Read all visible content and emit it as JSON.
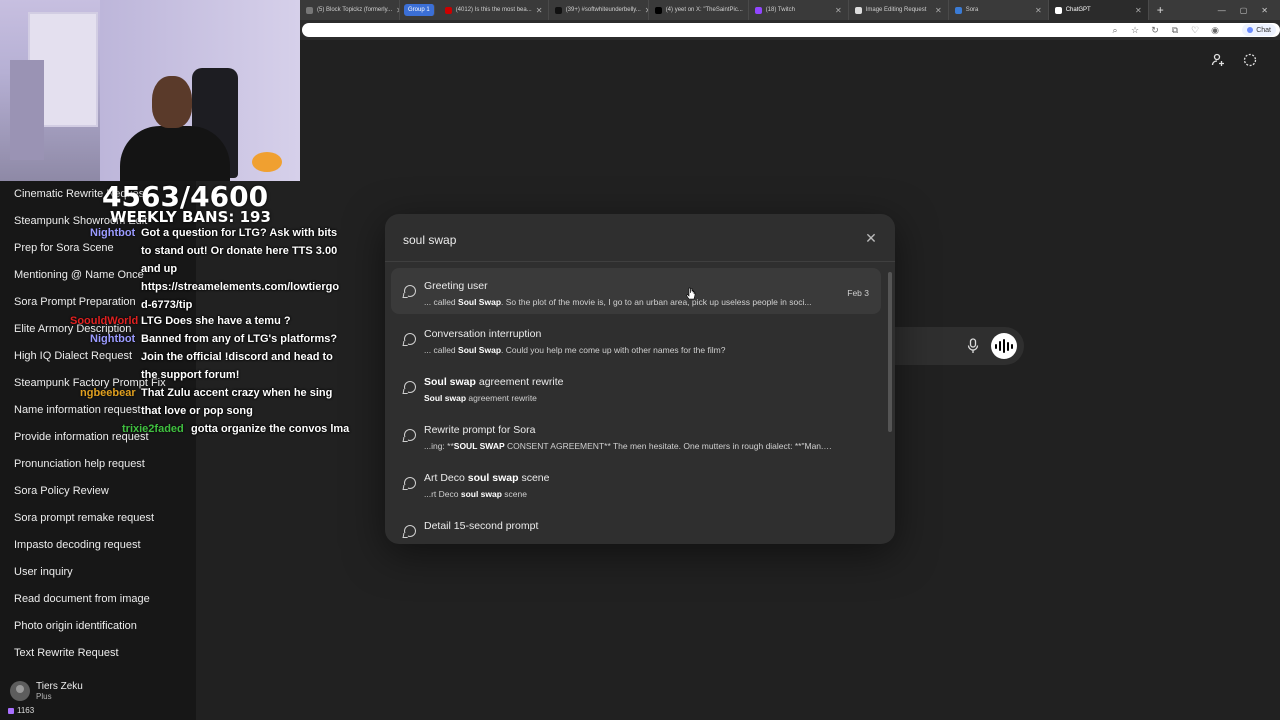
{
  "browser": {
    "tabs": [
      {
        "label": "(5) Block Topickz (formerly...",
        "active": false
      },
      {
        "label": "Group 1",
        "group": true
      },
      {
        "label": "(4012) Is this the most bea...",
        "active": false
      },
      {
        "label": "(39+) #softwhiteunderbelly...",
        "active": false
      },
      {
        "label": "(4) yeet on X: \"TheSaintPic...",
        "active": false
      },
      {
        "label": "(18) Twitch",
        "active": false
      },
      {
        "label": "Image Editing Request",
        "active": false
      },
      {
        "label": "Sora",
        "active": false
      },
      {
        "label": "ChatGPT",
        "active": true
      }
    ],
    "new_tab": "+",
    "chat_pill": "Chat"
  },
  "stream_overlay": {
    "ban_count": "4563/4600",
    "weekly_bans": "WEEKLY BANS: 193",
    "chat": [
      {
        "user": "Nightbot",
        "user_color": "#9b9bff",
        "lines": [
          "Got a question for LTG? Ask with bits",
          "to stand out! Or donate here TTS 3.00",
          "and up",
          "https://streamelements.com/lowtiergo",
          "d-6773/tip"
        ]
      },
      {
        "user": "SoouldWorld",
        "user_color": "#e02020",
        "lines": [
          "LTG Does she have a temu ?"
        ]
      },
      {
        "user": "Nightbot",
        "user_color": "#9b9bff",
        "lines": [
          "Banned from any of LTG's platforms?",
          "Join the official !discord and head to",
          "the support forum!"
        ]
      },
      {
        "user": "ngbeebear",
        "user_color": "#e0a020",
        "lines": [
          "That Zulu accent crazy when he sing",
          "that love or pop song"
        ]
      },
      {
        "user": "trixie2faded",
        "user_color": "#40c040",
        "lines": [
          "gotta organize the convos lma"
        ]
      }
    ],
    "viewer_count": "1163"
  },
  "sidebar": {
    "items": [
      "Cinematic Rewrite Request",
      "Steampunk Showroom Edit",
      "Prep for Sora Scene",
      "Mentioning @ Name Once",
      "Sora Prompt Preparation",
      "Elite Armory Description",
      "High IQ Dialect Request",
      "Steampunk Factory Prompt Fix",
      "Name information request",
      "Provide information request",
      "Pronunciation help request",
      "Sora Policy Review",
      "Sora prompt remake request",
      "Impasto decoding request",
      "User inquiry",
      "Read document from image",
      "Photo origin identification",
      "Text Rewrite Request"
    ],
    "user": {
      "name": "Tiers Zeku",
      "plan": "Plus"
    }
  },
  "search_modal": {
    "query": "soul swap",
    "results": [
      {
        "title_pre": "Greeting user",
        "title_bold": "",
        "title_post": "",
        "snippet_pre": "... called ",
        "snippet_bold": "Soul Swap",
        "snippet_post": ". So the plot of the movie is, I go to an urban area, pick up useless people in soci...",
        "date": "Feb 3"
      },
      {
        "title_pre": "Conversation interruption",
        "title_bold": "",
        "title_post": "",
        "snippet_pre": "... called ",
        "snippet_bold": "Soul Swap",
        "snippet_post": ". Could you help me come up with other names for the film?",
        "date": ""
      },
      {
        "title_pre": "",
        "title_bold": "Soul swap",
        "title_post": " agreement rewrite",
        "snippet_pre": "",
        "snippet_bold": "Soul swap",
        "snippet_post": " agreement rewrite",
        "date": ""
      },
      {
        "title_pre": "Rewrite prompt for Sora",
        "title_bold": "",
        "title_post": "",
        "snippet_pre": "...ing: **",
        "snippet_bold": "SOUL SWAP",
        "snippet_post": " CONSENT AGREEMENT** The men hesitate. One mutters in rough dialect: **\"Man... this s...",
        "date": ""
      },
      {
        "title_pre": "Art Deco ",
        "title_bold": "soul swap",
        "title_post": " scene",
        "snippet_pre": "...rt Deco ",
        "snippet_bold": "soul swap",
        "snippet_post": " scene",
        "date": ""
      },
      {
        "title_pre": "Detail 15-second prompt",
        "title_bold": "",
        "title_post": "",
        "snippet_pre": "",
        "snippet_bold": "",
        "snippet_post": "",
        "date": ""
      }
    ]
  },
  "colors": {
    "background": "#212121",
    "sidebar": "#171717",
    "modal": "#2f2f2f",
    "hover": "#3a3a3a"
  }
}
